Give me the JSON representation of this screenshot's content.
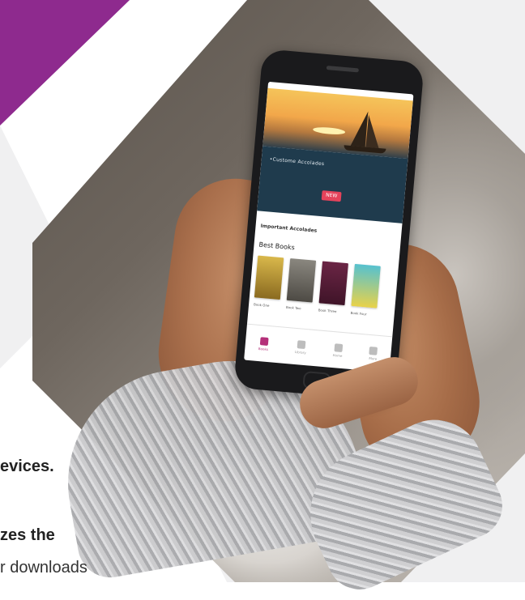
{
  "colors": {
    "accent": "#8e2a8e",
    "app_accent": "#b5307a",
    "hero_panel": "#1f3b4d",
    "hero_button": "#e5435b"
  },
  "text": {
    "line1": "evices.",
    "line2": "zes the",
    "line3": "r downloads"
  },
  "app": {
    "hero_caption": "•Custome Accolades",
    "hero_button": "NEW",
    "section_small": "Important Accolades",
    "section_big": "Best Books",
    "books": [
      {
        "caption": "Book One",
        "color": "#c7a13a"
      },
      {
        "caption": "Book Two",
        "color": "#6d6a63"
      },
      {
        "caption": "Book Three",
        "color": "#5c1f3b"
      },
      {
        "caption": "Book Four",
        "color": "#4bb7c7"
      }
    ],
    "tabs": [
      {
        "label": "Books",
        "icon": "book-icon"
      },
      {
        "label": "Library",
        "icon": "library-icon"
      },
      {
        "label": "Home",
        "icon": "home-icon"
      },
      {
        "label": "More",
        "icon": "more-icon"
      }
    ]
  }
}
